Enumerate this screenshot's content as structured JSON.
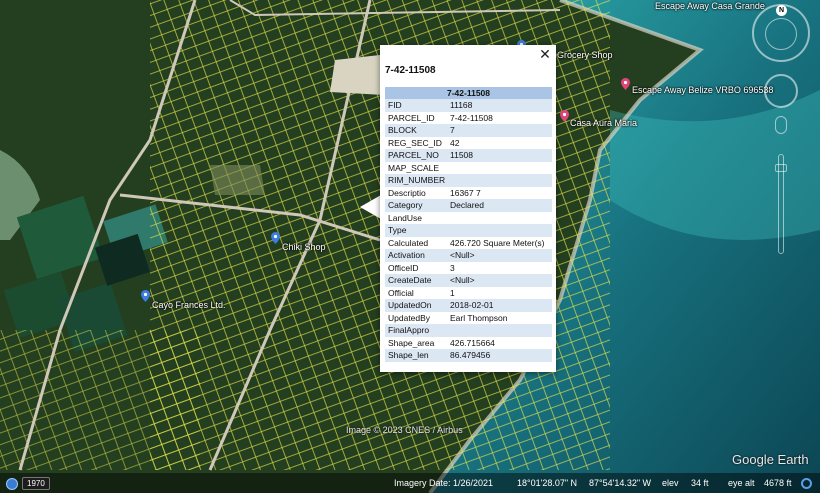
{
  "balloon": {
    "heading": "7-42-11508",
    "table_header": "7-42-11508",
    "close_glyph": "✕",
    "rows": [
      {
        "k": "FID",
        "v": "11168"
      },
      {
        "k": "PARCEL_ID",
        "v": "7-42-11508"
      },
      {
        "k": "BLOCK",
        "v": "7"
      },
      {
        "k": "REG_SEC_ID",
        "v": "42"
      },
      {
        "k": "PARCEL_NO",
        "v": "11508"
      },
      {
        "k": "MAP_SCALE",
        "v": ""
      },
      {
        "k": "RIM_NUMBER",
        "v": ""
      },
      {
        "k": "Descriptio",
        "v": "16367 7"
      },
      {
        "k": "Category",
        "v": "Declared"
      },
      {
        "k": "LandUse",
        "v": ""
      },
      {
        "k": "Type",
        "v": ""
      },
      {
        "k": "Calculated",
        "v": "426.720 Square Meter(s)"
      },
      {
        "k": "Activation",
        "v": "<Null>"
      },
      {
        "k": "OfficeID",
        "v": "3"
      },
      {
        "k": "CreateDate",
        "v": "<Null>"
      },
      {
        "k": "Official",
        "v": "1"
      },
      {
        "k": "UpdatedOn",
        "v": "2018-02-01"
      },
      {
        "k": "UpdatedBy",
        "v": "Earl Thompson"
      },
      {
        "k": "FinalAppro",
        "v": ""
      },
      {
        "k": "Shape_area",
        "v": "426.715664"
      },
      {
        "k": "Shape_len",
        "v": "86.479456"
      }
    ]
  },
  "places": {
    "escape_casa_grande": "Escape Away Casa Grande",
    "grocery": "Grocery Shop",
    "escape_vrbo": "Escape Away Belize VRBO 696538",
    "casa_aura": "Casa Aura Maria",
    "chiki": "Chiki Shop",
    "cayo": "Cayo Frances Ltd."
  },
  "nav": {
    "north_label": "N"
  },
  "credit": "Image © 2023 CNES / Airbus",
  "logo": "Google Earth",
  "status": {
    "year": "1970",
    "imagery_date": "Imagery Date: 1/26/2021",
    "lat": "18°01'28.07\" N",
    "lon": "87°54'14.32\" W",
    "elev_label": "elev",
    "elev_value": "34 ft",
    "eye_label": "eye alt",
    "eye_value": "4678 ft"
  },
  "colors": {
    "parcel_line": "#e6e64a",
    "road": "#cfc8b8",
    "sea": "#1f8a93",
    "land": "#2a4a24",
    "pin_blue": "#3b7de0",
    "pin_pink": "#e0457a"
  }
}
